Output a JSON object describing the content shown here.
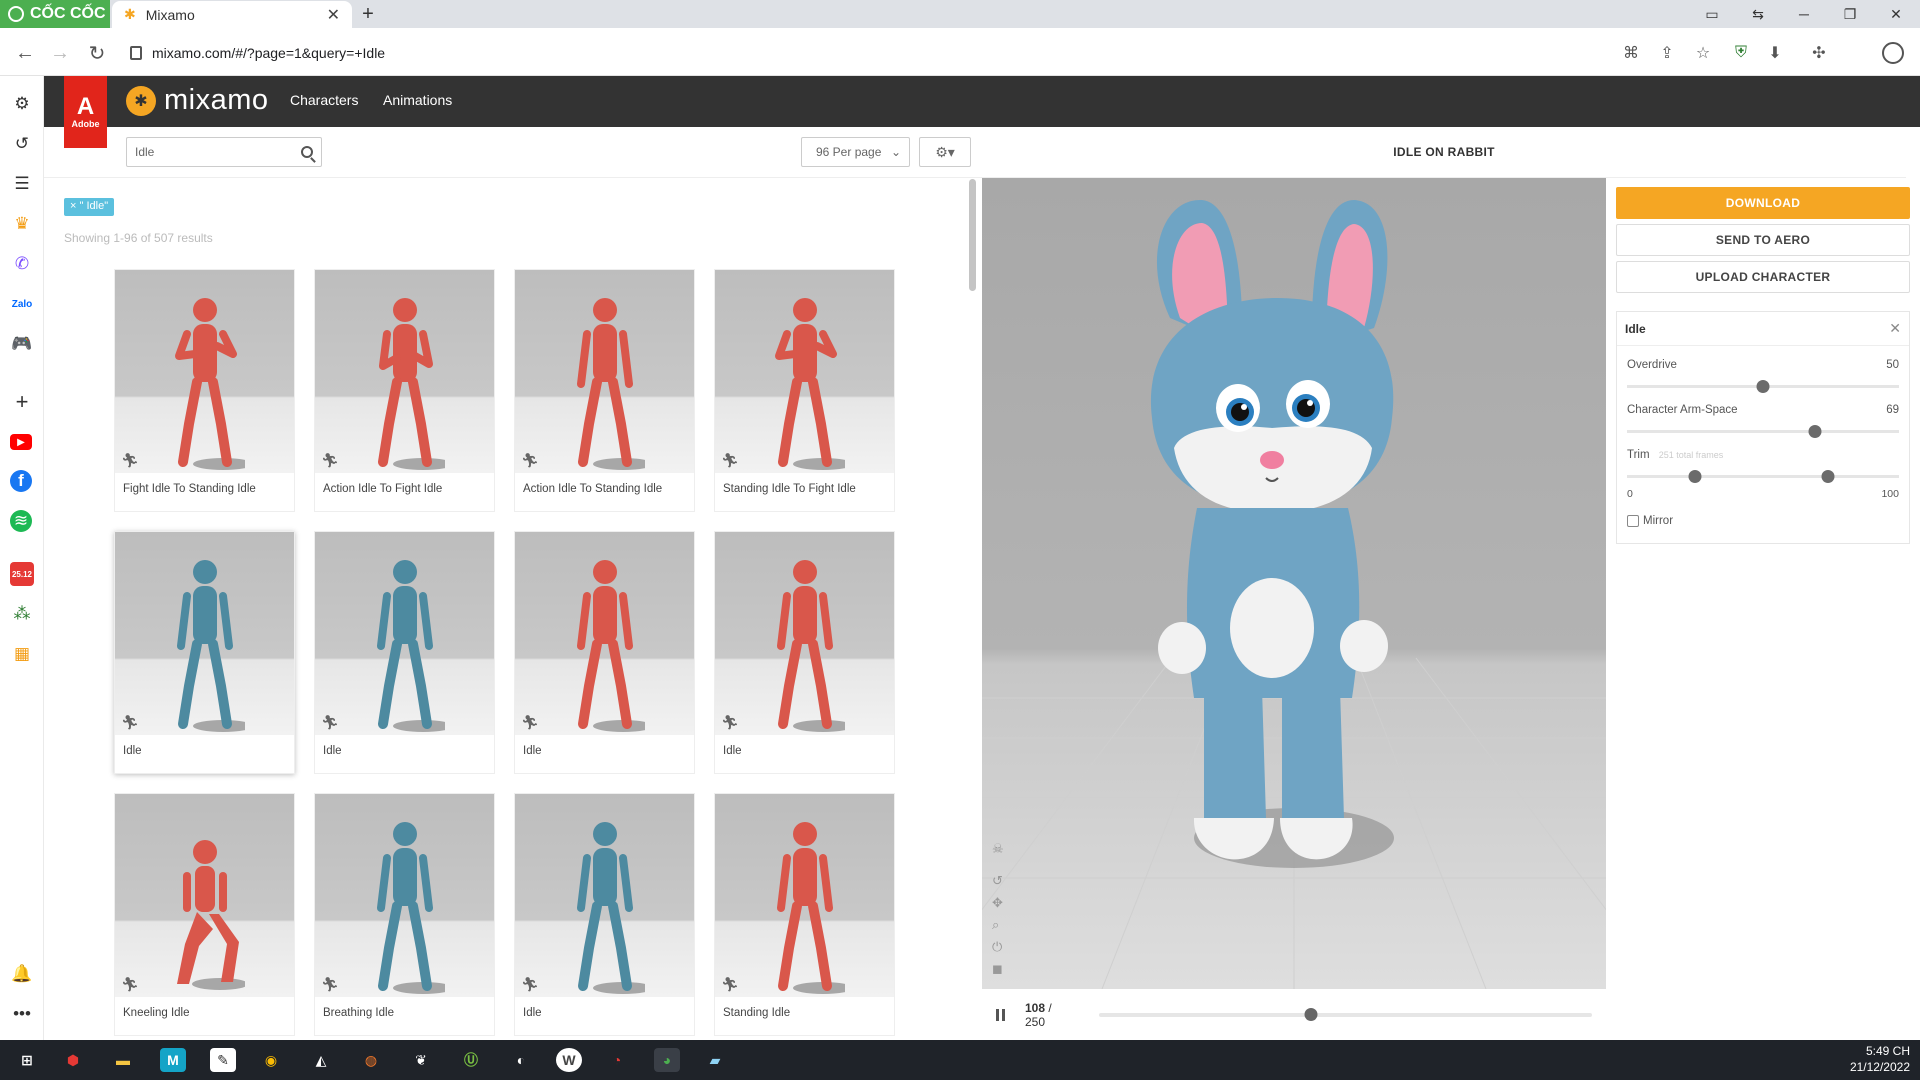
{
  "browser": {
    "brand": "CỐC CỐC",
    "tab_title": "Mixamo",
    "url": "mixamo.com/#/?page=1&query=+Idle"
  },
  "app": {
    "adobe_label": "Adobe",
    "logo_text": "mixamo",
    "nav": [
      "Characters",
      "Animations"
    ]
  },
  "search": {
    "query": "Idle",
    "per_page": "96 Per page",
    "tag": "\" Idle\"",
    "result_count": "Showing 1-96 of 507 results"
  },
  "results": [
    {
      "label": "Fight Idle To Standing Idle",
      "color": "#d9574b",
      "pose": "guard"
    },
    {
      "label": "Action Idle To Fight Idle",
      "color": "#d9574b",
      "pose": "crouch"
    },
    {
      "label": "Action Idle To Standing Idle",
      "color": "#d9574b",
      "pose": "stand"
    },
    {
      "label": "Standing Idle To Fight Idle",
      "color": "#d9574b",
      "pose": "guard"
    },
    {
      "label": "Idle",
      "color": "#4d8aa0",
      "pose": "stand"
    },
    {
      "label": "Idle",
      "color": "#4d8aa0",
      "pose": "stand"
    },
    {
      "label": "Idle",
      "color": "#d9574b",
      "pose": "stand"
    },
    {
      "label": "Idle",
      "color": "#d9574b",
      "pose": "stand"
    },
    {
      "label": "Kneeling Idle",
      "color": "#d9574b",
      "pose": "kneel"
    },
    {
      "label": "Breathing Idle",
      "color": "#4d8aa0",
      "pose": "stand"
    },
    {
      "label": "Idle",
      "color": "#4d8aa0",
      "pose": "stand"
    },
    {
      "label": "Standing Idle",
      "color": "#d9574b",
      "pose": "stand"
    }
  ],
  "preview": {
    "title": "IDLE ON RABBIT",
    "frame": "108",
    "total_frames": "250",
    "progress": 0.43
  },
  "panel": {
    "download": "DOWNLOAD",
    "send_to_aero": "SEND TO AERO",
    "upload_character": "UPLOAD CHARACTER",
    "animation_name": "Idle",
    "overdrive_label": "Overdrive",
    "overdrive_value": "50",
    "overdrive_fraction": 0.5,
    "armspace_label": "Character Arm-Space",
    "armspace_value": "69",
    "armspace_fraction": 0.69,
    "trim_label": "Trim",
    "trim_hint": "251 total frames",
    "trim_min": "0",
    "trim_max": "100",
    "trim_start_fraction": 0.25,
    "trim_end_fraction": 0.74,
    "mirror_label": "Mirror"
  },
  "taskbar": {
    "time": "5:49 CH",
    "date": "21/12/2022"
  },
  "colors": {
    "accent": "#f5a623",
    "header": "#333333",
    "adobe_red": "#e1251b",
    "tag": "#5bc0de"
  }
}
